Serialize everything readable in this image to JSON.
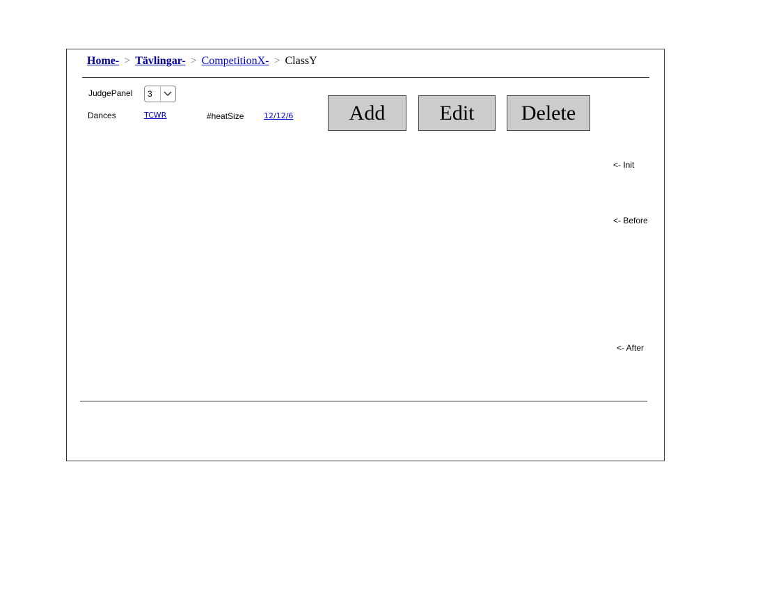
{
  "breadcrumb": {
    "items": [
      {
        "label": "Home-"
      },
      {
        "label": "Tävlingar-"
      },
      {
        "label": "CompetitionX-"
      }
    ],
    "current": "ClassY",
    "separator": ">"
  },
  "form": {
    "judge_panel_label": "JudgePanel",
    "judge_panel_value": "3",
    "dances_label": "Dances",
    "dances_value": "TCWR",
    "heat_size_label": "#heatSize",
    "heat_size_value": "12/12/6"
  },
  "actions": {
    "add_label": "Add",
    "edit_label": "Edit",
    "delete_label": "Delete"
  },
  "annotations": {
    "init": "<- Init",
    "before": "<- Before",
    "after": "<- After"
  }
}
